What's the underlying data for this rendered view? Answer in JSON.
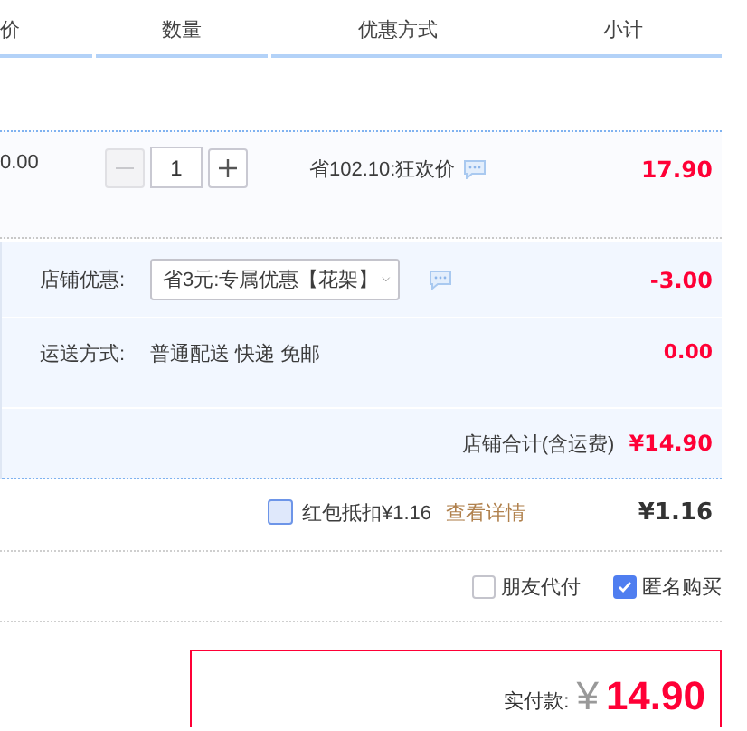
{
  "columns": [
    {
      "label": "价"
    },
    {
      "label": "数量"
    },
    {
      "label": "优惠方式"
    },
    {
      "label": "小计"
    }
  ],
  "item": {
    "price": "0.00",
    "quantity": "1",
    "minus_disabled": true,
    "promotion": "省102.10:狂欢价",
    "subtotal": "17.90"
  },
  "shop": {
    "discount_label": "店铺优惠:",
    "discount_choice": "省3元:专属优惠【花架】",
    "discount_amount": "-3.00",
    "shipping_label": "运送方式:",
    "shipping_method": "普通配送 快递 免邮",
    "shipping_fee": "0.00",
    "total_label": "店铺合计(含运费)",
    "total": "¥14.90"
  },
  "red_packet": {
    "checked": false,
    "label": "红包抵扣¥1.16",
    "link": "查看详情",
    "amount": "¥1.16"
  },
  "options": [
    {
      "label": "朋友代付",
      "checked": false
    },
    {
      "label": "匿名购买",
      "checked": true
    }
  ],
  "payment": {
    "label": "实付款:",
    "currency": "¥",
    "amount": "14.90"
  }
}
